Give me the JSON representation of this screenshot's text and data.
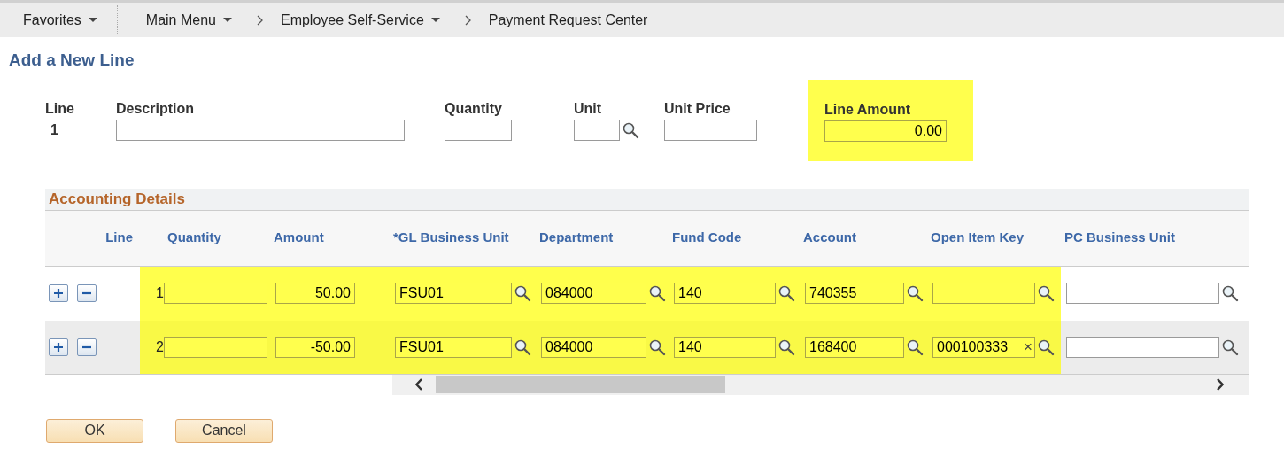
{
  "nav": {
    "items": [
      {
        "label": "Favorites",
        "dropdown": true,
        "divider_after": true
      },
      {
        "label": "Main Menu",
        "dropdown": true,
        "divider_after": false
      },
      {
        "label": "Employee Self-Service",
        "dropdown": true,
        "divider_after": false
      },
      {
        "label": "Payment Request Center",
        "dropdown": false,
        "divider_after": false
      }
    ]
  },
  "title": "Add a New Line",
  "line_form": {
    "line_label": "Line",
    "line_number": "1",
    "fields": [
      {
        "label": "Description",
        "lookup": false,
        "highlighted": false
      },
      {
        "label": "Quantity",
        "lookup": false,
        "highlighted": false
      },
      {
        "label": "Unit",
        "lookup": true,
        "highlighted": false
      },
      {
        "label": "Unit Price",
        "lookup": false,
        "highlighted": false
      },
      {
        "label": "Line Amount",
        "value": "0.00",
        "lookup": false,
        "highlighted": true
      }
    ]
  },
  "accounting": {
    "title": "Accounting Details",
    "line_header": "Line",
    "columns": [
      {
        "label": "Quantity",
        "lookup": false
      },
      {
        "label": "Amount",
        "lookup": false
      },
      {
        "label": "*GL Business Unit",
        "lookup": true
      },
      {
        "label": "Department",
        "lookup": true
      },
      {
        "label": "Fund Code",
        "lookup": true
      },
      {
        "label": "Account",
        "lookup": true
      },
      {
        "label": "Open Item Key",
        "lookup": true
      },
      {
        "label": "PC Business Unit",
        "lookup": true
      }
    ],
    "rows": [
      {
        "line": "1",
        "highlighted": true,
        "cells": [
          {
            "highlighted": true
          },
          {
            "value": "50.00",
            "highlighted": true
          },
          {
            "value": "FSU01",
            "highlighted": true
          },
          {
            "value": "084000",
            "highlighted": true
          },
          {
            "value": "140",
            "highlighted": true
          },
          {
            "value": "740355",
            "highlighted": true
          },
          {
            "highlighted": true
          },
          {
            "highlighted": false
          }
        ]
      },
      {
        "line": "2",
        "highlighted": true,
        "cells": [
          {
            "highlighted": true
          },
          {
            "value": "-50.00",
            "highlighted": true
          },
          {
            "value": "FSU01",
            "highlighted": true
          },
          {
            "value": "084000",
            "highlighted": true
          },
          {
            "value": "140",
            "highlighted": true
          },
          {
            "value": "168400",
            "highlighted": true
          },
          {
            "value": "000100333",
            "highlighted": true,
            "clear": "×"
          },
          {
            "highlighted": false
          }
        ]
      }
    ]
  },
  "buttons": [
    "OK",
    "Cancel"
  ]
}
